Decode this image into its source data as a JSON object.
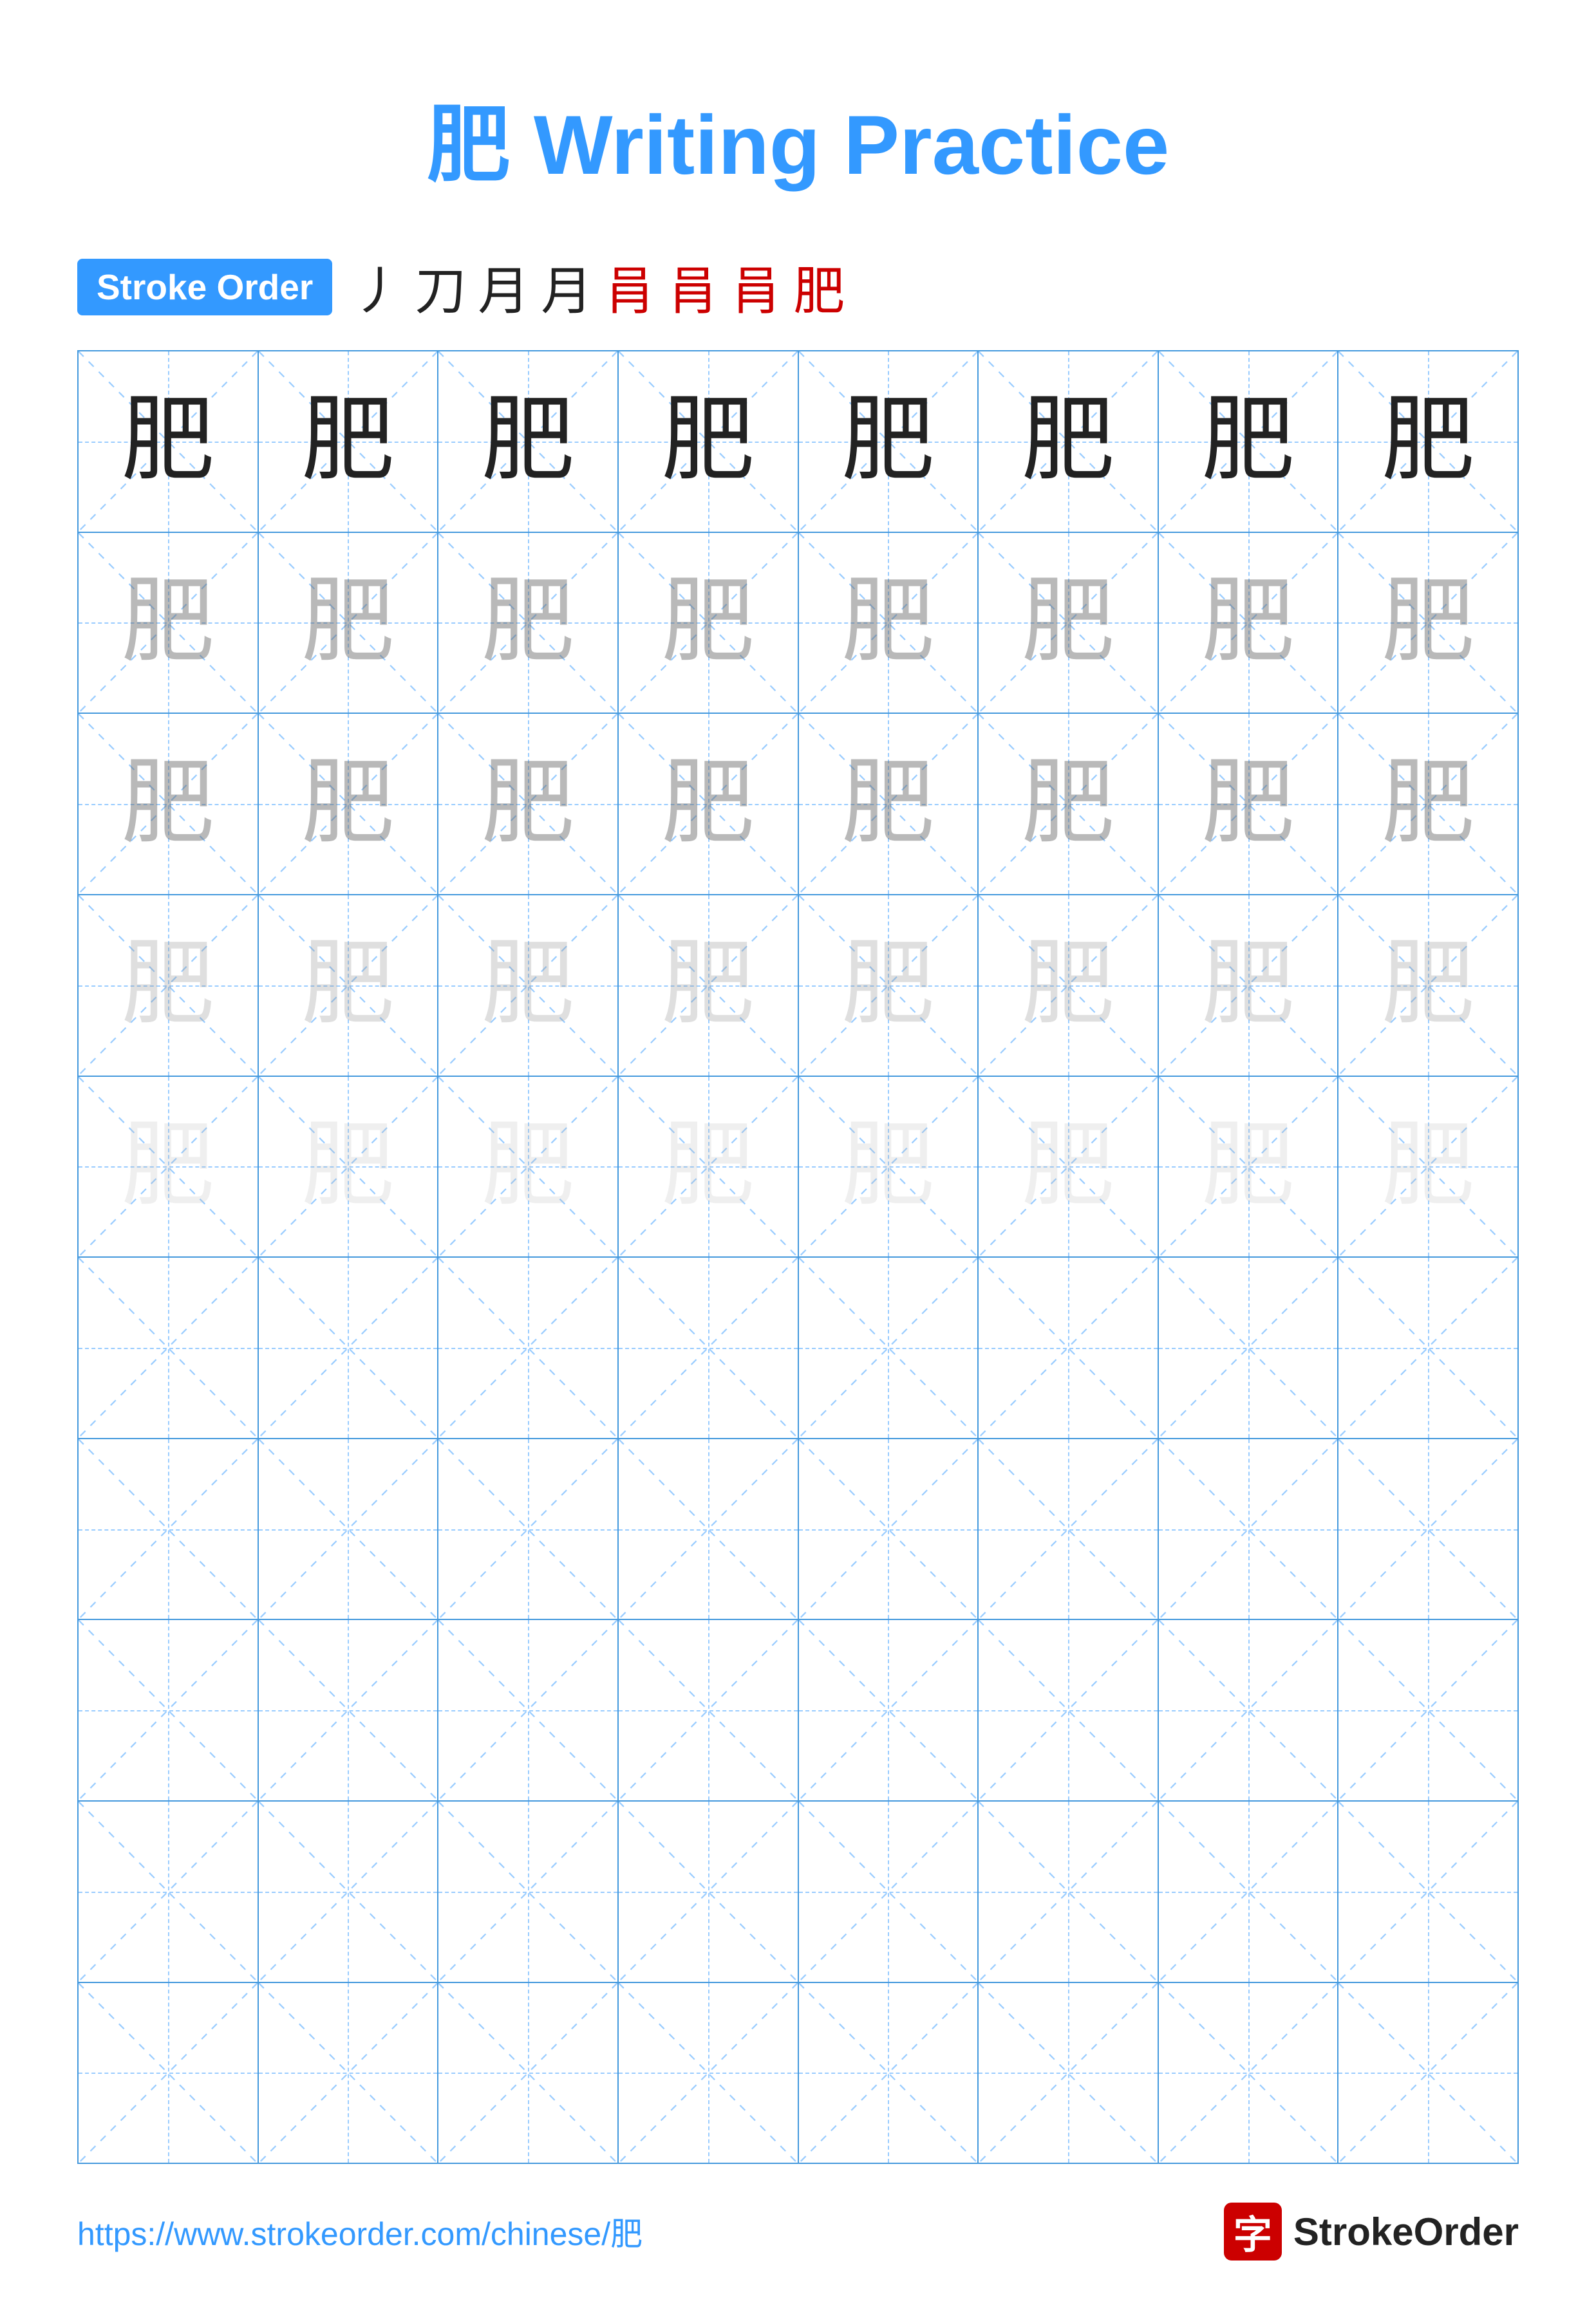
{
  "title": "肥 Writing Practice",
  "stroke_order": {
    "badge_label": "Stroke Order",
    "strokes": [
      "丿",
      "刀",
      "月",
      "月",
      "肙",
      "肙",
      "肙",
      "肥"
    ]
  },
  "grid": {
    "rows": 10,
    "cols": 8,
    "character": "肥",
    "filled_rows": 5,
    "char_opacities": [
      "dark",
      "light1",
      "light1",
      "light2",
      "light3"
    ]
  },
  "footer": {
    "url": "https://www.strokeorder.com/chinese/肥",
    "logo_char": "字",
    "logo_text": "StrokeOrder"
  }
}
